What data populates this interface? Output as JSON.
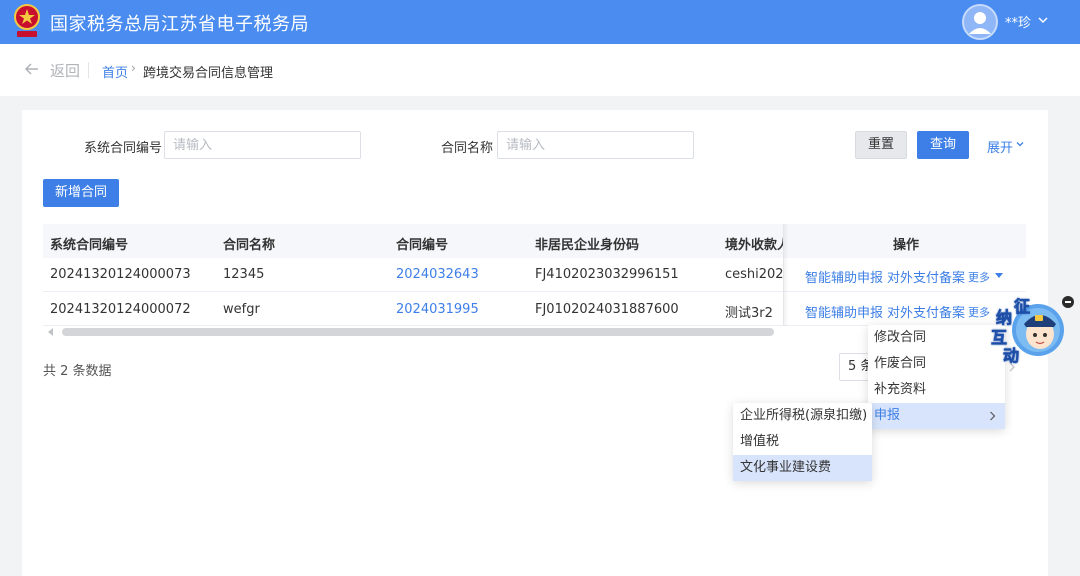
{
  "header": {
    "site_title": "国家税务总局江苏省电子税务局",
    "user_name": "**珍"
  },
  "breadcrumb": {
    "back_label": "返回",
    "home": "首页",
    "separator": "›",
    "current": "跨境交易合同信息管理"
  },
  "filters": {
    "contract_sys_no_label": "系统合同编号",
    "contract_sys_no_placeholder": "请输入",
    "contract_name_label": "合同名称",
    "contract_name_placeholder": "请输入",
    "reset_label": "重置",
    "query_label": "查询",
    "expand_label": "展开"
  },
  "actions": {
    "add_label": "新增合同"
  },
  "table": {
    "columns": [
      "系统合同编号",
      "合同名称",
      "合同编号",
      "非居民企业身份码",
      "境外收款人",
      "操作"
    ],
    "rows": [
      {
        "sys_no": "20241320124000073",
        "name": "12345",
        "contract_no": "2024032643",
        "nonresident_id": "FJ4102023032996151",
        "payee": "ceshi2023",
        "op_assist": "智能辅助申报",
        "op_record": "对外支付备案",
        "op_more": "更多"
      },
      {
        "sys_no": "20241320124000072",
        "name": "wefgr",
        "contract_no": "2024031995",
        "nonresident_id": "FJ0102024031887600",
        "payee": "测试3r2",
        "op_assist": "智能辅助申报",
        "op_record": "对外支付备案",
        "op_more": "更多"
      }
    ]
  },
  "pagination": {
    "total_text": "共 2 条数据",
    "page_size": "5 条"
  },
  "more_menu": {
    "items": [
      "修改合同",
      "作废合同",
      "补充资料",
      "申报"
    ]
  },
  "declare_submenu": {
    "items": [
      "企业所得税(源泉扣缴)",
      "增值税",
      "文化事业建设费"
    ]
  },
  "mascot": {
    "chars": [
      "征",
      "纳",
      "互",
      "动"
    ]
  },
  "colors": {
    "header_bg": "#4a8cf0",
    "primary": "#3d7fe6",
    "menu_highlight": "#d7e4fb"
  }
}
